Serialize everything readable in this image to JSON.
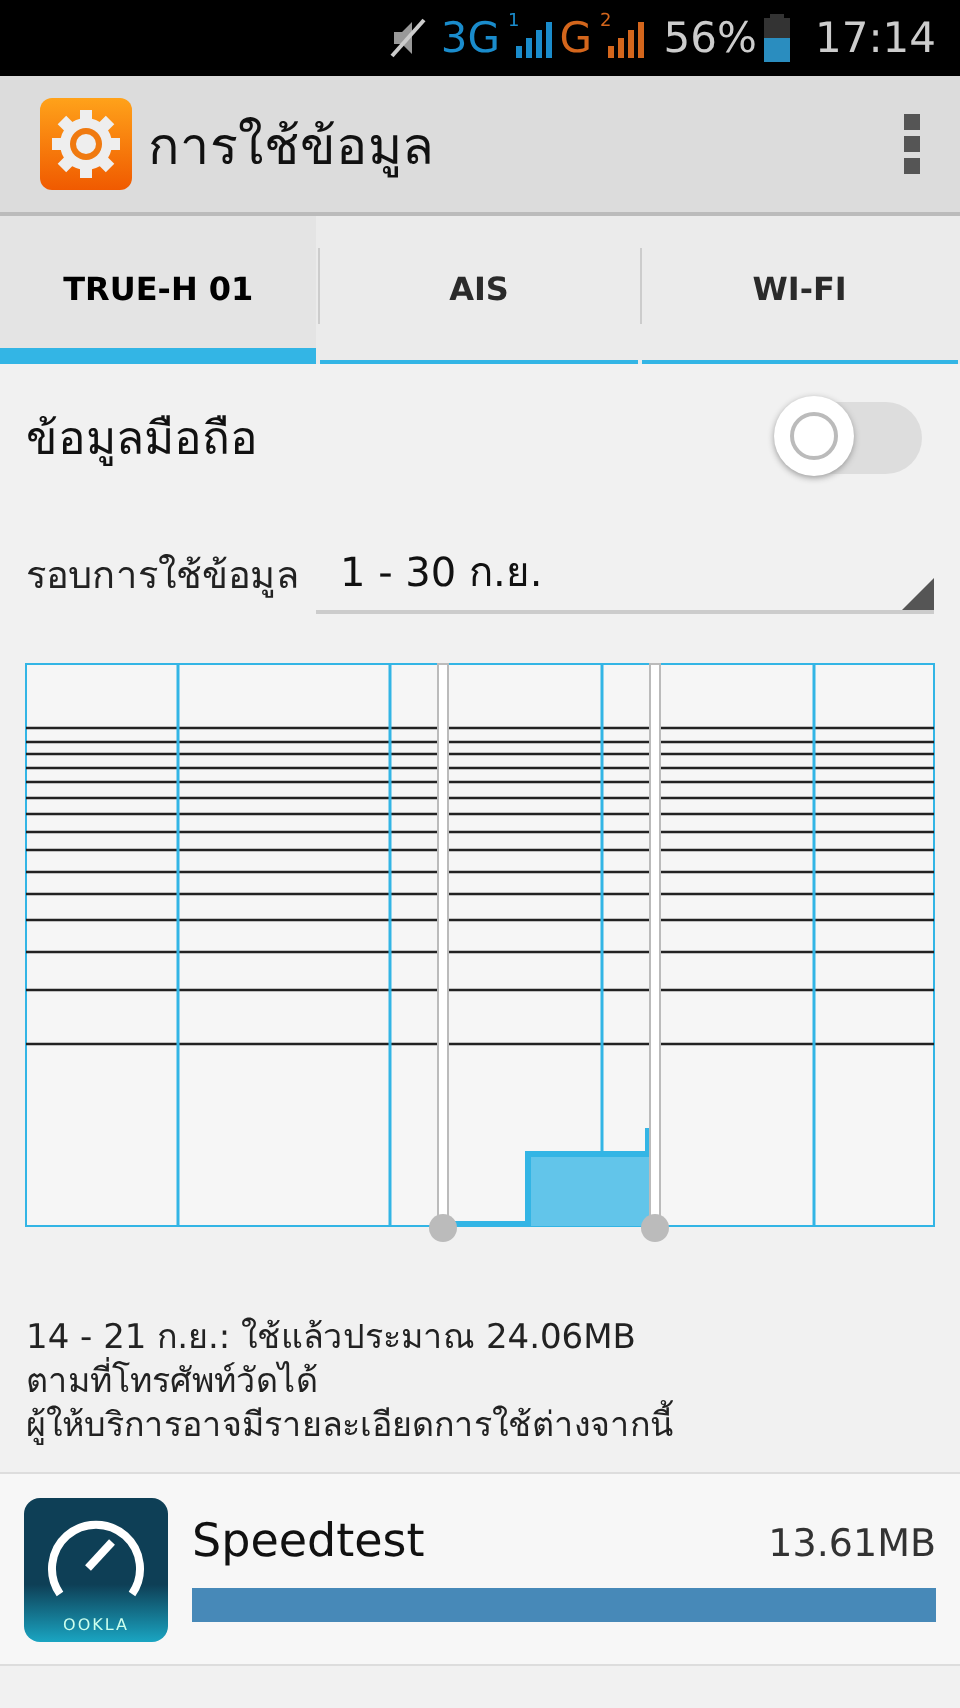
{
  "status_bar": {
    "network_1": "3G",
    "sim_1": "1",
    "network_2": "G",
    "sim_2": "2",
    "battery": "56%",
    "time": "17:14"
  },
  "action_bar": {
    "title": "การใช้ข้อมูล"
  },
  "tabs": [
    {
      "label": "TRUE-H 01",
      "selected": true
    },
    {
      "label": "AIS",
      "selected": false
    },
    {
      "label": "WI-FI",
      "selected": false
    }
  ],
  "mobile_data": {
    "label": "ข้อมูลมือถือ",
    "on": false
  },
  "cycle": {
    "label": "รอบการใช้ข้อมูล",
    "value": "1 - 30 ก.ย."
  },
  "summary": [
    "14 - 21 ก.ย.: ใช้แล้วประมาณ 24.06MB",
    "ตามที่โทรศัพท์วัดได้",
    "ผู้ให้บริการอาจมีรายละเอียดการใช้ต่างจากนี้"
  ],
  "apps": [
    {
      "name": "Speedtest",
      "usage": "13.61MB",
      "icon_text": "OOKLA"
    }
  ]
}
